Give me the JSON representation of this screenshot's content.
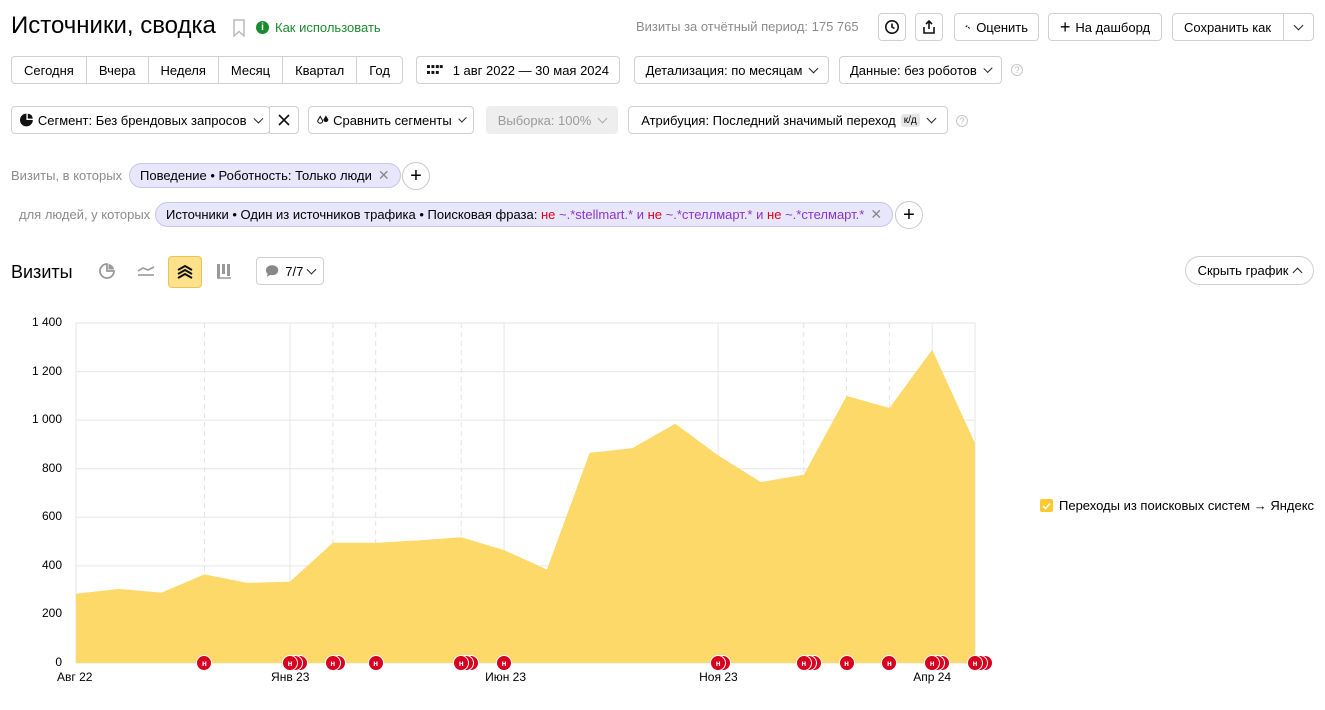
{
  "header": {
    "title": "Источники, сводка",
    "how_to_use": "Как использовать",
    "visits_summary": "Визиты за отчётный период: 175 765",
    "rate_label": "Оценить",
    "dashboard_label": "На дашборд",
    "save_as_label": "Сохранить как"
  },
  "period_tabs": [
    "Сегодня",
    "Вчера",
    "Неделя",
    "Месяц",
    "Квартал",
    "Год"
  ],
  "date_range": "1 авг 2022 — 30 мая 2024",
  "detail": "Детализация: по месяцам",
  "data_filter": "Данные: без роботов",
  "segment": "Сегмент: Без брендовых запросов",
  "compare": "Сравнить сегменты",
  "sample": "Выборка: 100%",
  "attribution": "Атрибуция: Последний значимый переход",
  "attribution_badge": "к/д",
  "filters": {
    "visits_label": "Визиты, в которых",
    "visits_chip": "Поведение • Роботность: Только люди",
    "people_label": "для людей, у которых",
    "people_chip_prefix": "Источники • Один из источников трафика • Поисковая фраза:",
    "not_word": "не",
    "and_word": "и",
    "pattern1": "~.*stellmart.*",
    "pattern2": "~.*стеллмарт.*",
    "pattern3": "~.*стелмарт.*"
  },
  "chart_section": {
    "title": "Визиты",
    "comments_count": "7/7",
    "hide_chart": "Скрыть график",
    "legend_label": "Переходы из поисковых систем → Яндекс",
    "annotation_glyph": "н"
  },
  "chart_data": {
    "type": "area",
    "x": [
      "2022-08",
      "2022-09",
      "2022-10",
      "2022-11",
      "2022-12",
      "2023-01",
      "2023-02",
      "2023-03",
      "2023-04",
      "2023-05",
      "2023-06",
      "2023-07",
      "2023-08",
      "2023-09",
      "2023-10",
      "2023-11",
      "2023-12",
      "2024-01",
      "2024-02",
      "2024-03",
      "2024-04",
      "2024-05"
    ],
    "series": [
      {
        "name": "Переходы из поисковых систем → Яндекс",
        "color": "#fdd96a",
        "values": [
          285,
          305,
          290,
          365,
          330,
          335,
          495,
          495,
          505,
          518,
          465,
          385,
          865,
          885,
          985,
          855,
          745,
          775,
          1100,
          1050,
          1290,
          905
        ]
      }
    ],
    "ylim": [
      0,
      1400
    ],
    "yticks": [
      "0",
      "200",
      "400",
      "600",
      "800",
      "1 000",
      "1 200",
      "1 400"
    ],
    "xticks": [
      {
        "index": 0,
        "label": "Авг 22"
      },
      {
        "index": 5,
        "label": "Янв 23"
      },
      {
        "index": 10,
        "label": "Июн 23"
      },
      {
        "index": 15,
        "label": "Ноя 23"
      },
      {
        "index": 20,
        "label": "Апр 24"
      }
    ],
    "dashed_grid_indices": [
      3,
      6,
      7,
      9,
      17,
      18,
      19
    ],
    "annotation_groups": [
      {
        "pos": 3,
        "count": 1
      },
      {
        "pos": 5,
        "count": 3
      },
      {
        "pos": 6,
        "count": 2
      },
      {
        "pos": 7,
        "count": 1
      },
      {
        "pos": 9,
        "count": 3
      },
      {
        "pos": 10,
        "count": 1
      },
      {
        "pos": 15,
        "count": 2
      },
      {
        "pos": 17,
        "count": 3
      },
      {
        "pos": 18,
        "count": 1
      },
      {
        "pos": 19,
        "count": 1
      },
      {
        "pos": 20,
        "count": 3
      },
      {
        "pos": 21,
        "count": 3
      }
    ]
  }
}
